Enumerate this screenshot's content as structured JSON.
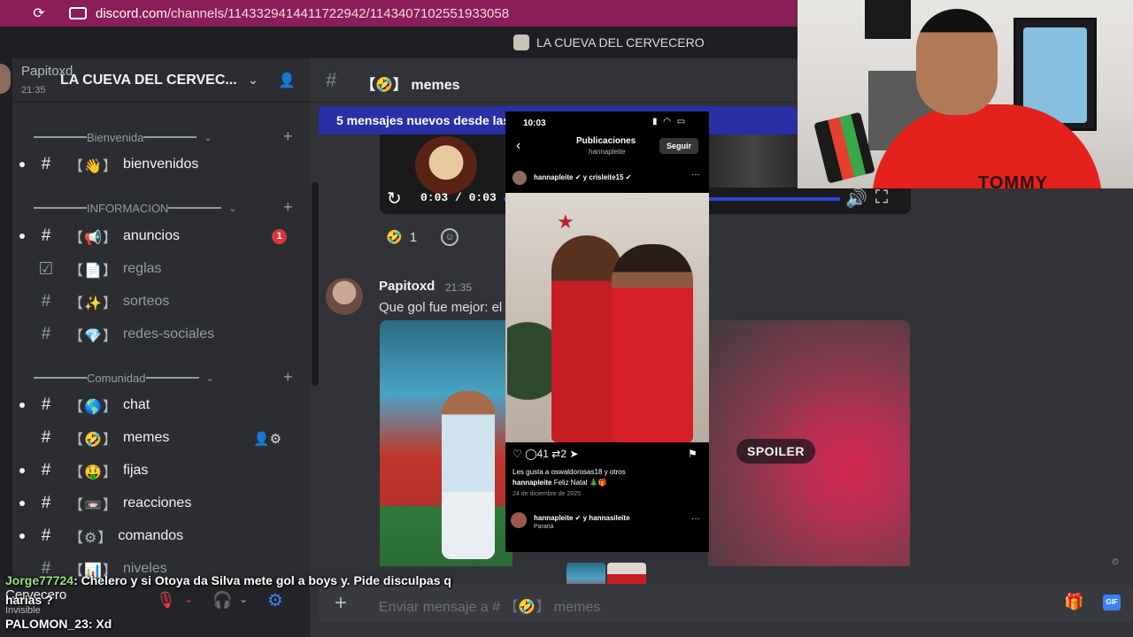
{
  "browser": {
    "url_host": "discord.com",
    "url_path": "/channels/1143329414411722942/1143407102551933058"
  },
  "window": {
    "title": "LA CUEVA DEL CERVECERO"
  },
  "server": {
    "name": "LA CUEVA DEL CERVEC..."
  },
  "overlay_message": {
    "author": "Papitoxd",
    "time": "21:35"
  },
  "categories": [
    {
      "name": "Bienvenida"
    },
    {
      "name": "INFORMACION"
    },
    {
      "name": "Comunidad"
    }
  ],
  "channels": [
    {
      "emoji": "【👋】",
      "name": "bienvenidos"
    },
    {
      "emoji": "【📢】",
      "name": "anuncios",
      "badge": "1"
    },
    {
      "emoji": "【📄】",
      "name": "reglas"
    },
    {
      "emoji": "【✨】",
      "name": "sorteos"
    },
    {
      "emoji": "【💎】",
      "name": "redes-sociales"
    },
    {
      "emoji": "【🌎】",
      "name": "chat"
    },
    {
      "emoji": "【🤣】",
      "name": "memes"
    },
    {
      "emoji": "【🤑】",
      "name": "fijas"
    },
    {
      "emoji": "【📼】",
      "name": "reacciones"
    },
    {
      "emoji": "【⚙】",
      "name": "comandos"
    },
    {
      "emoji": "【📊】",
      "name": "niveles"
    }
  ],
  "user_panel": {
    "name": "Cervecero",
    "status": "Invisible"
  },
  "chat": {
    "channel_name": "【🤣】 memes",
    "new_messages_banner": "5 mensajes nuevos desde las",
    "video_time": "0:03 / 0:03",
    "reaction_count": "1",
    "message": {
      "author": "Papitoxd",
      "time": "21:35",
      "text": "Que gol fue mejor: el"
    },
    "spoiler_label": "SPOILER",
    "composer_placeholder": "Enviar mensaje a # 【🤣】 memes"
  },
  "phone": {
    "time": "10:03",
    "title": "Publicaciones",
    "subtitle": "hannapleite",
    "follow_label": "Seguir",
    "post_user": "hannapleite ✔ y crisleite15 ✔",
    "comments": "41",
    "reposts": "2",
    "likes_text": "Les gusta a oswaldorosas18 y otros",
    "caption_user": "hannapleite",
    "caption_text": "Feliz Natal 🎄🎁",
    "date": "24 de diciembre de 2025",
    "next_user": "hannapleite ✔ y hannasileite",
    "next_location": "Paraná"
  },
  "webcam": {
    "shirt_text": "TOMMY"
  },
  "stream_chat": [
    {
      "user": "Jorge77724",
      "text": ": Chelero y si Otoya da Silva mete gol a boys y. Pide disculpas q"
    },
    {
      "user": "",
      "text": "harias ?"
    },
    {
      "user": "PALOMON_23",
      "text": ": Xd"
    }
  ],
  "colors": {
    "url_bar": "#8b1e58",
    "sidebar": "#2b2d31",
    "chat_bg": "#313338",
    "accent": "#3b82f6",
    "badge": "#da373c",
    "new_banner": "#2a2fa5"
  },
  "icons": [
    "reload-icon",
    "hash-icon",
    "chevron-down-icon",
    "add-member-icon",
    "plus-icon",
    "mic-muted-icon",
    "headphones-icon",
    "gear-icon",
    "gift-icon",
    "gif-icon",
    "volume-icon",
    "fullscreen-icon",
    "replay-icon"
  ]
}
